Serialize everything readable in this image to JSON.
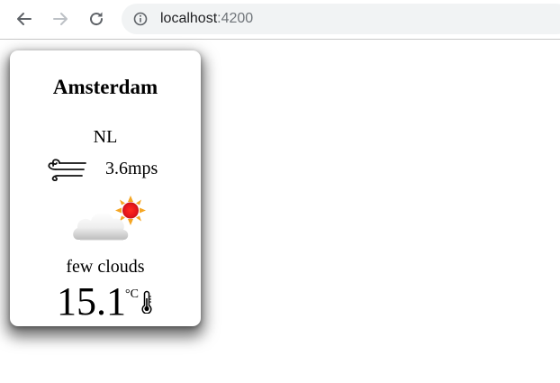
{
  "browser": {
    "url_host": "localhost",
    "url_port": ":4200",
    "icons": {
      "back": "back-arrow-icon",
      "forward": "forward-arrow-icon",
      "reload": "reload-icon",
      "info": "info-icon"
    }
  },
  "weather_card": {
    "city": "Amsterdam",
    "country": "NL",
    "wind_speed": "3.6mps",
    "description": "few clouds",
    "temperature": "15.1",
    "temperature_unit": "°C",
    "icons": {
      "wind": "wind-icon",
      "weather": "few-clouds-icon",
      "thermometer": "thermometer-icon"
    },
    "colors": {
      "sun": "#f5a623",
      "sun_core": "#e8161b",
      "cloud": "#e6e6e6"
    }
  }
}
